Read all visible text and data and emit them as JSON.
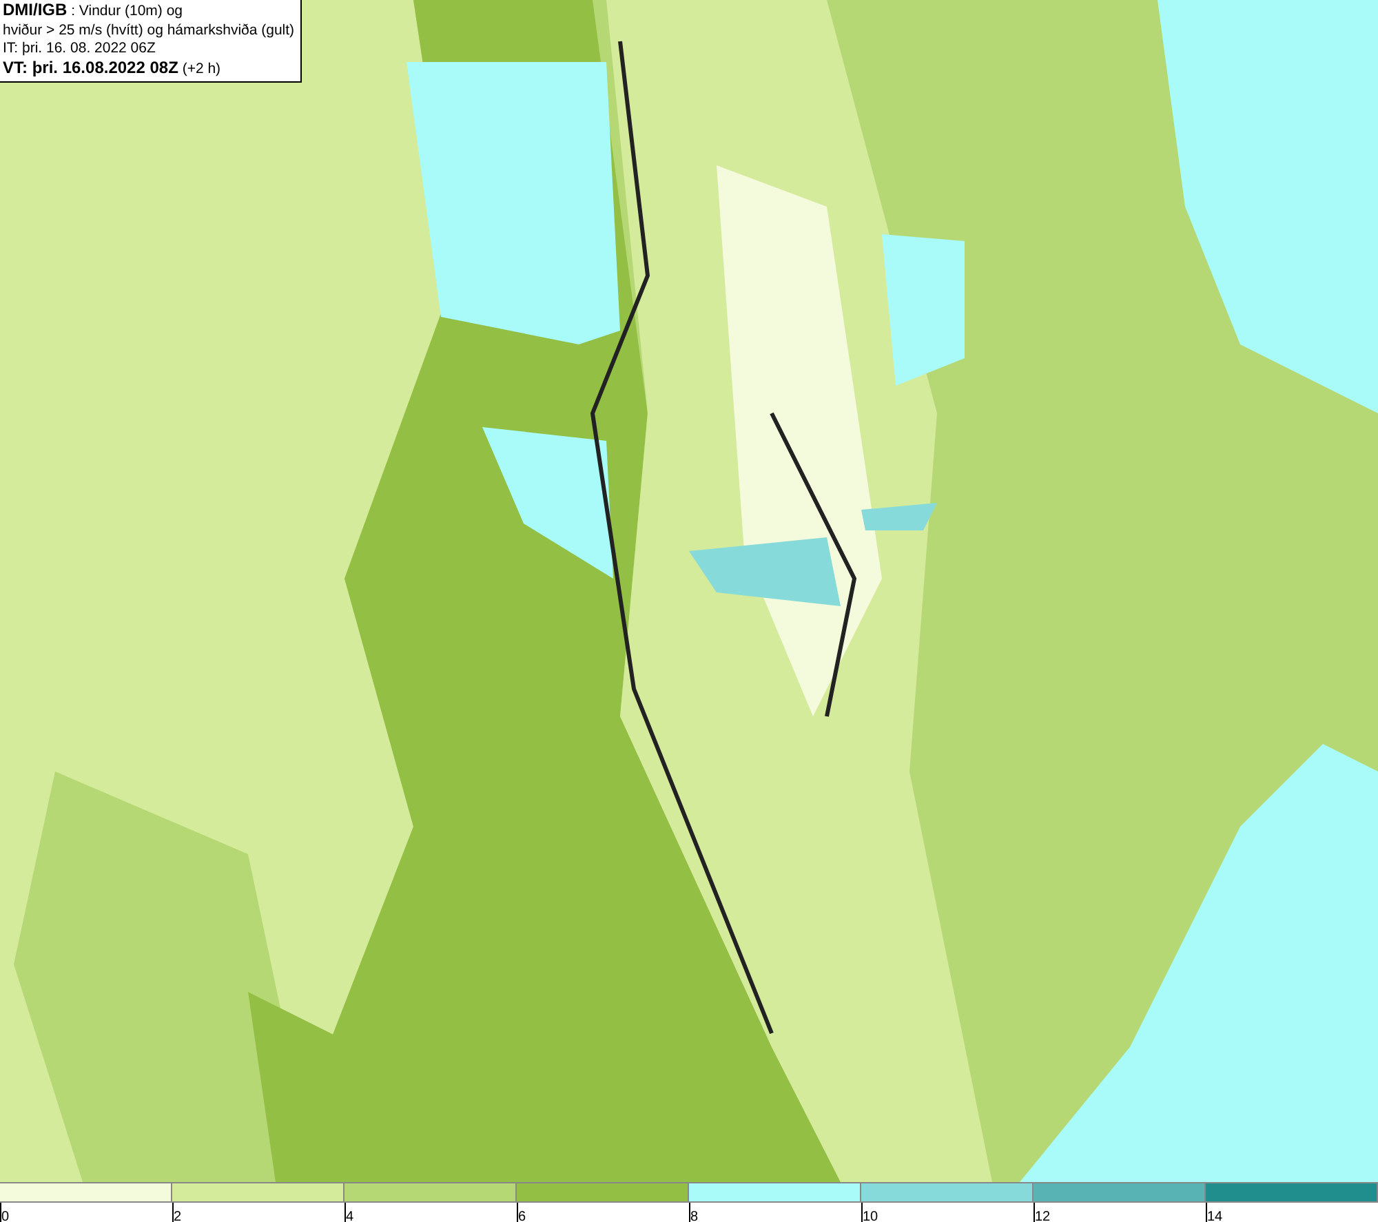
{
  "header": {
    "lines": [
      "**DMI/IGB** : Vindur (10m) og",
      "hviður > 25 m/s (hvítt) og hámarkshviða (gult)",
      "IT: þri. 16. 08. 2022 06Z",
      "**VT: þri. 16.08.2022 08Z** (+2 h)"
    ]
  },
  "legend": {
    "bins": [
      {
        "color": "#f4fadc"
      },
      {
        "color": "#d4eb9b"
      },
      {
        "color": "#b6d874"
      },
      {
        "color": "#94bf45"
      },
      {
        "color": "#a9fbf9"
      },
      {
        "color": "#86dad9"
      },
      {
        "color": "#58b4b4"
      },
      {
        "color": "#218e8e"
      }
    ],
    "labels": [
      "0",
      "2",
      "4",
      "6",
      "8",
      "10",
      "12",
      "14"
    ]
  }
}
